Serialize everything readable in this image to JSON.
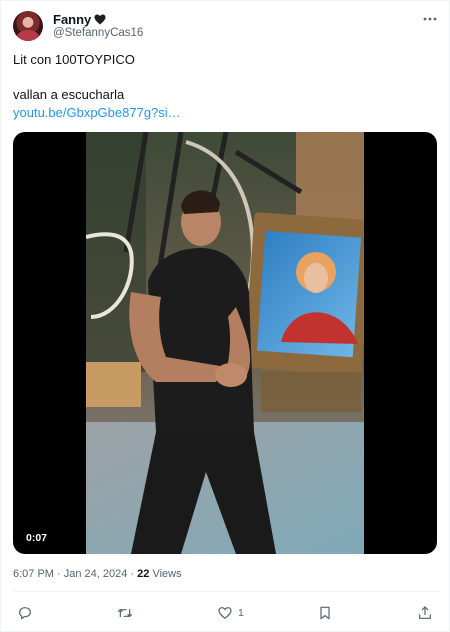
{
  "tweet": {
    "display_name": "Fanny",
    "handle": "@StefannyCas16",
    "text_line1": "Lit con 100TOYPICO",
    "text_line2": "vallan a escucharla",
    "link": "youtu.be/GbxpGbe877g?si…",
    "video_duration": "0:07",
    "time": "6:07 PM · Jan 24, 2024 · ",
    "views_count": "22",
    "views_label": " Views"
  },
  "actions": {
    "reply_icon": "reply-icon",
    "retweet_icon": "retweet-icon",
    "like_icon": "heart-icon",
    "like_count": "1",
    "bookmark_icon": "bookmark-icon",
    "share_icon": "share-icon"
  },
  "colors": {
    "text": "#0f1419",
    "muted": "#536471",
    "link": "#1d9bf0"
  }
}
